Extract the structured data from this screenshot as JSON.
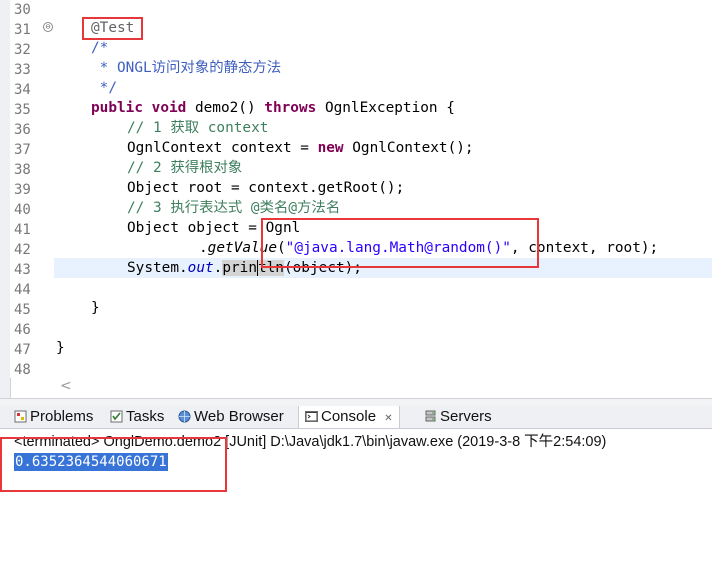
{
  "editor": {
    "line_numbers": [
      "30",
      "31",
      "32",
      "33",
      "34",
      "35",
      "36",
      "37",
      "38",
      "39",
      "40",
      "41",
      "42",
      "43",
      "44",
      "45",
      "46",
      "47",
      "48"
    ],
    "fold_glyph": "⊖",
    "lines": {
      "l31": "@Test",
      "l32": "/*",
      "l33": " * ONGL访问对象的静态方法",
      "l34": " */",
      "l35_kw1": "public",
      "l35_kw2": "void",
      "l35_name": " demo2() ",
      "l35_kw3": "throws",
      "l35_rest": " OgnlException {",
      "l36": "// 1 获取 context",
      "l37_a": "OgnlContext context = ",
      "l37_kw": "new",
      "l37_b": " OgnlContext();",
      "l38": "// 2 获得根对象",
      "l39": "Object root = context.getRoot();",
      "l40": "// 3 执行表达式 @类名@方法名",
      "l41": "Object object = Ognl",
      "l42_a": ".",
      "l42_method": "getValue",
      "l42_b": "(",
      "l42_str": "\"@java.lang.Math@random()\"",
      "l42_c": ", context, root);",
      "l43_a": "System.",
      "l43_out": "out",
      "l43_b": ".",
      "l43_occ1": "prin",
      "l43_occ2": "tln",
      "l43_c": "(object);",
      "l45": "}",
      "l47": "}"
    },
    "scroll_arrow": "<"
  },
  "tabs": [
    {
      "label": "Problems",
      "icon": "problems-icon"
    },
    {
      "label": "Tasks",
      "icon": "tasks-icon"
    },
    {
      "label": "Web Browser",
      "icon": "globe-icon"
    },
    {
      "label": "Console",
      "icon": "console-icon",
      "close": "✕"
    },
    {
      "label": "Servers",
      "icon": "servers-icon"
    }
  ],
  "console": {
    "status": "<terminated> OnglDemo.demo2 [JUnit] D:\\Java\\jdk1.7\\bin\\javaw.exe (2019-3-8 下午2:54:09)",
    "output": "0.6352364544060671"
  },
  "colors": {
    "highlight_box": "#e8373a",
    "selection": "#3874d8",
    "keyword": "#7f0055",
    "comment": "#3f7f5f",
    "javadoc": "#3f5fbf",
    "string": "#2a00ff"
  }
}
